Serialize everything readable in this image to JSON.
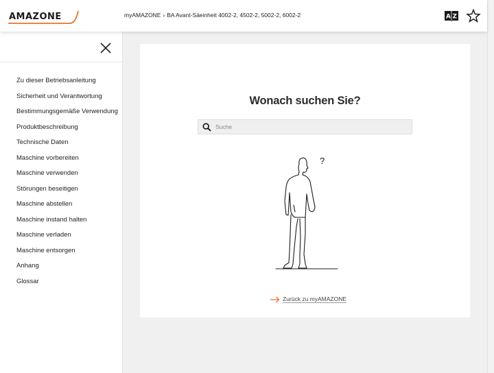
{
  "header": {
    "logo_text": "AMAZONE",
    "breadcrumb": {
      "root": "myAMAZONE",
      "separator": "›",
      "current": "BA Avant-Säeinheit 4002-2, 4502-2, 5002-2, 6002-2"
    },
    "icons": [
      "book-az-icon",
      "star-icon"
    ]
  },
  "sidebar": {
    "close_icon": "close-icon",
    "items": [
      {
        "label": "Zu dieser Betriebsanleitung"
      },
      {
        "label": "Sicherheit und Verantwortung"
      },
      {
        "label": "Bestimmungsgemäße Verwendung"
      },
      {
        "label": "Produktbeschreibung"
      },
      {
        "label": "Technische Daten"
      },
      {
        "label": "Maschine vorbereiten"
      },
      {
        "label": "Maschine verwenden"
      },
      {
        "label": "Störungen beseitigen"
      },
      {
        "label": "Maschine abstellen"
      },
      {
        "label": "Maschine instand halten"
      },
      {
        "label": "Maschine verladen"
      },
      {
        "label": "Maschine entsorgen"
      },
      {
        "label": "Anhang"
      },
      {
        "label": "Glossar"
      }
    ]
  },
  "main": {
    "title": "Wonach suchen Sie?",
    "search": {
      "placeholder": "Suche",
      "value": ""
    },
    "figure_mark": "?",
    "back_link": "Zurück zu myAMAZONE"
  },
  "colors": {
    "accent": "#e8732a",
    "background": "#f0f0f0",
    "card": "#ffffff"
  }
}
